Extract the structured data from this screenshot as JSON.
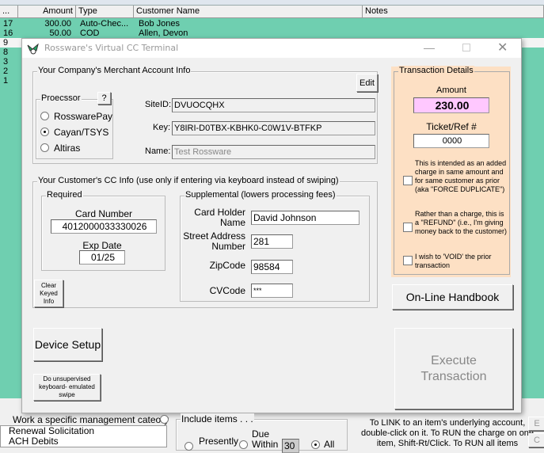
{
  "grid": {
    "headers": [
      "...",
      "Amount",
      "Type",
      "Customer Name",
      "Notes"
    ],
    "rows": [
      {
        "num": "17",
        "amount": "300.00",
        "type": "Auto-Chec...",
        "name": "Bob Jones"
      },
      {
        "num": "16",
        "amount": "50.00",
        "type": "COD",
        "name": "Allen, Devon"
      },
      {
        "num": "9",
        "amount": "",
        "type": "",
        "name": ""
      },
      {
        "num": "8",
        "amount": "",
        "type": "",
        "name": ""
      },
      {
        "num": "3",
        "amount": "",
        "type": "",
        "name": ""
      },
      {
        "num": "2",
        "amount": "",
        "type": "",
        "name": ""
      },
      {
        "num": "1",
        "amount": "",
        "type": "",
        "name": ""
      }
    ]
  },
  "dialog": {
    "title": "Rossware's Virtual CC Terminal",
    "merchant": {
      "label": "Your Company's Merchant Account Info",
      "edit": "Edit",
      "processor_label": "Proecssor",
      "help": "?",
      "processors": [
        "RosswarePay",
        "Cayan/TSYS",
        "Altiras"
      ],
      "selected_processor": "Cayan/TSYS",
      "siteid_label": "SiteID:",
      "siteid": "DVUOCQHX",
      "key_label": "Key:",
      "key": "Y8IRI-D0TBX-KBHK0-C0W1V-BTFKP",
      "name_label": "Name:",
      "name": "Test Rossware"
    },
    "customer": {
      "label": "Your Customer's CC Info (use only if entering via keyboard instead of swiping)",
      "required_label": "Required",
      "card_number_label": "Card Number",
      "card_number": "4012000033330026",
      "exp_label": "Exp Date",
      "exp": "01/25",
      "supplemental_label": "Supplemental (lowers processing fees)",
      "holder_label": "Card Holder Name",
      "holder": "David Johnson",
      "street_label": "Street Address Number",
      "street": "281",
      "zip_label": "ZipCode",
      "zip": "98584",
      "cvc_label": "CVCode",
      "cvc": "***",
      "clear": "Clear Keyed Info"
    },
    "device_setup": "Device Setup",
    "unsupervised": "Do unsupervised keyboard- emulated swipe",
    "transaction": {
      "label": "Transaction Details",
      "amount_label": "Amount",
      "amount": "230.00",
      "ticket_label": "Ticket/Ref #",
      "ticket": "0000",
      "dup": "This is intended as an added charge in same amount and for same customer as prior (aka \"FORCE DUPLICATE\")",
      "refund": "Rather than a charge, this is a \"REFUND\" (i.e., I'm giving money back to the customer)",
      "void": "I wish to 'VOID' the prior transaction"
    },
    "handbook": "On-Line Handbook",
    "execute": "Execute Transaction"
  },
  "bottom": {
    "category_label": "Work a specific management cateory",
    "list": [
      "Renewal Solicitation",
      "ACH Debits"
    ],
    "include_label": "Include items . . .",
    "presently": "Presently",
    "due_within": "Due Within",
    "days": "30",
    "all": "All",
    "help_text": "To LINK to an item's underlying account, double-click on it.  To RUN the charge on one item, Shift-Rt/Click.  To RUN all items",
    "btn_e": "E",
    "btn_c": "C"
  },
  "colors": {
    "grid": "#6fcfb0",
    "peach": "#fde0c4",
    "amount_bg": "#ffc8ff"
  }
}
